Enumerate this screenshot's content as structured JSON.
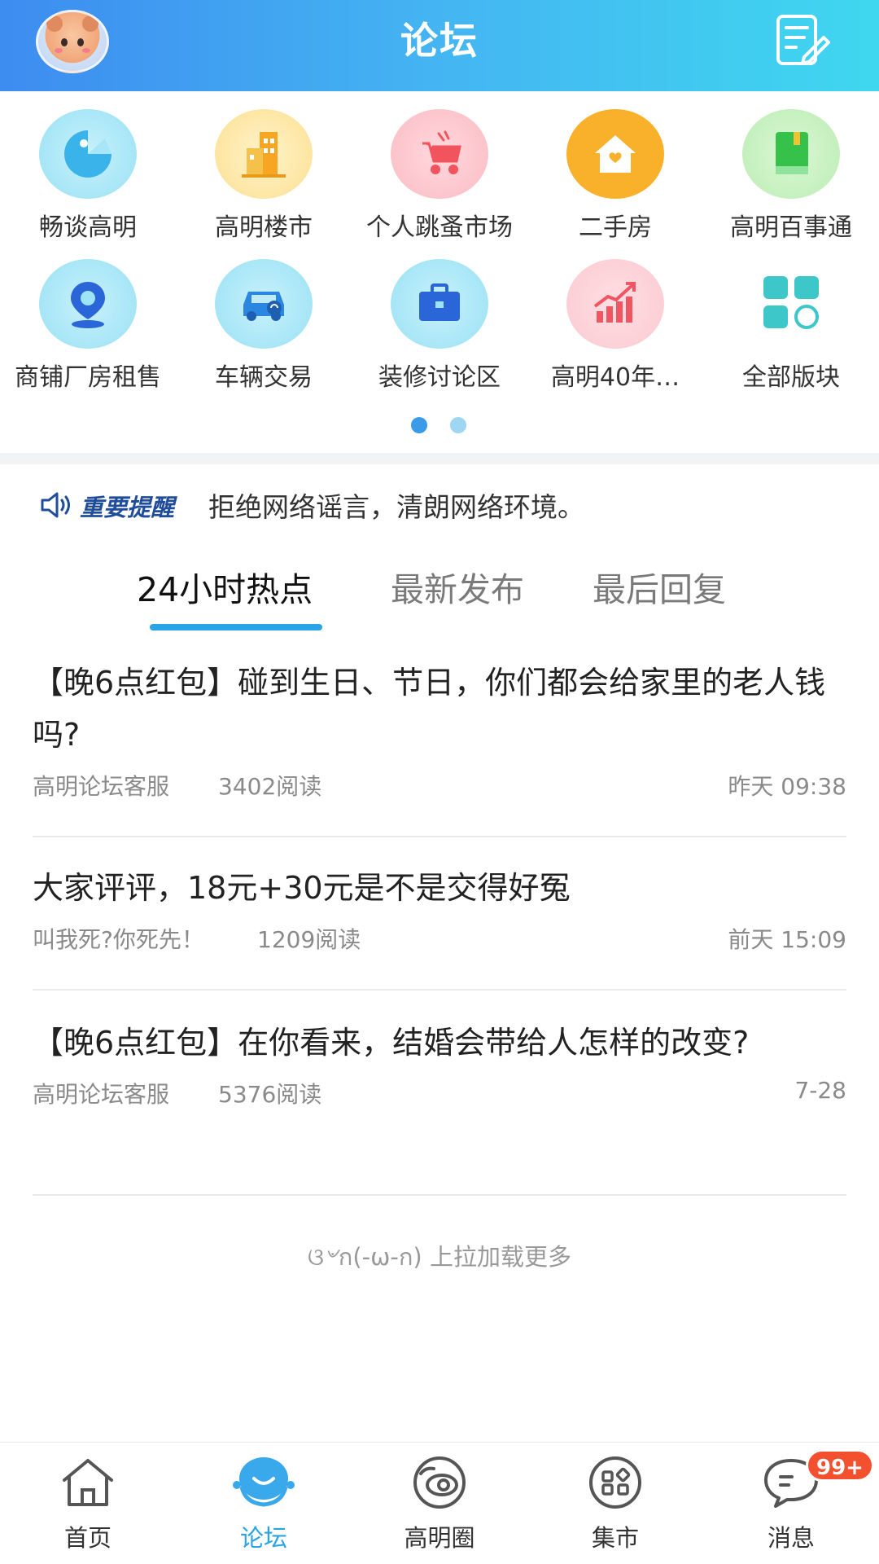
{
  "header": {
    "title": "论坛",
    "avatar_icon": "user-avatar",
    "compose_icon": "compose-icon",
    "gradient_start": "#3d8cf0",
    "gradient_end": "#3fd7ef"
  },
  "categories": [
    {
      "label": "畅谈高明",
      "icon": "chat-icon"
    },
    {
      "label": "高明楼市",
      "icon": "building-icon"
    },
    {
      "label": "个人跳蚤市场",
      "icon": "stroller-icon"
    },
    {
      "label": "二手房",
      "icon": "house-icon"
    },
    {
      "label": "高明百事通",
      "icon": "book-icon"
    },
    {
      "label": "商铺厂房租售",
      "icon": "location-icon"
    },
    {
      "label": "车辆交易",
      "icon": "car-icon"
    },
    {
      "label": "装修讨论区",
      "icon": "toolbox-icon"
    },
    {
      "label": "高明40年…",
      "icon": "growth-chart-icon"
    },
    {
      "label": "全部版块",
      "icon": "grid-icon"
    }
  ],
  "notice": {
    "label": "重要提醒",
    "text": "拒绝网络谣言，清朗网络环境。"
  },
  "tabs": [
    {
      "label": "24小时热点",
      "active": true
    },
    {
      "label": "最新发布",
      "active": false
    },
    {
      "label": "最后回复",
      "active": false
    }
  ],
  "posts": [
    {
      "title": "【晚6点红包】碰到生日、节日，你们都会给家里的老人钱吗?",
      "author": "高明论坛客服",
      "reads": "3402阅读",
      "time": "昨天 09:38"
    },
    {
      "title": "大家评评，18元+30元是不是交得好冤",
      "author": "叫我死?你死先！",
      "reads": "1209阅读",
      "time": "前天 15:09"
    },
    {
      "title": "【晚6点红包】在你看来，结婚会带给人怎样的改变?",
      "author": "高明论坛客服",
      "reads": "5376阅读",
      "time": "7-28"
    }
  ],
  "load_more": "ଓ৺ก(-ω-ก) 上拉加载更多",
  "bottom_nav": [
    {
      "label": "首页",
      "icon": "home-icon",
      "active": false
    },
    {
      "label": "论坛",
      "icon": "forum-icon",
      "active": true
    },
    {
      "label": "高明圈",
      "icon": "circle-icon",
      "active": false
    },
    {
      "label": "集市",
      "icon": "market-icon",
      "active": false
    },
    {
      "label": "消息",
      "icon": "message-icon",
      "active": false,
      "badge": "99+"
    }
  ],
  "pager": {
    "pages": 2,
    "current": 1
  },
  "colors": {
    "accent": "#2aa4e6",
    "badge": "#f2502f",
    "notice_label": "#1f4d9c"
  }
}
